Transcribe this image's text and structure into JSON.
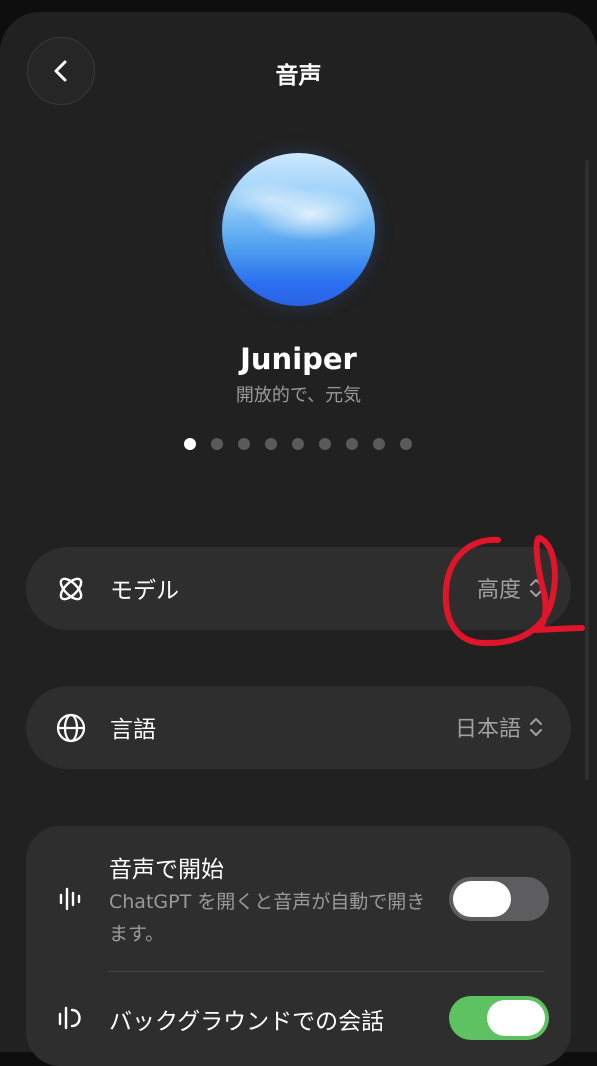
{
  "header": {
    "title": "音声",
    "back_icon": "chevron-left-icon"
  },
  "voice": {
    "name": "Juniper",
    "description": "開放的で、元気",
    "page_count": 9,
    "active_index": 0
  },
  "settings": {
    "model": {
      "label": "モデル",
      "value": "高度",
      "icon": "model-atom-icon"
    },
    "language": {
      "label": "言語",
      "value": "日本語",
      "icon": "globe-icon"
    }
  },
  "options": {
    "start_with_voice": {
      "title": "音声で開始",
      "description": "ChatGPT を開くと音声が自動で開きます。",
      "enabled": false,
      "icon": "waveform-icon"
    },
    "background_conversation": {
      "title": "バックグラウンドでの会話",
      "enabled": true,
      "icon": "background-voice-icon"
    }
  },
  "colors": {
    "background": "#212121",
    "row_background": "#2e2e2e",
    "toggle_on": "#5ec263",
    "toggle_off": "#5d5d60",
    "annotation": "#e0142a"
  }
}
